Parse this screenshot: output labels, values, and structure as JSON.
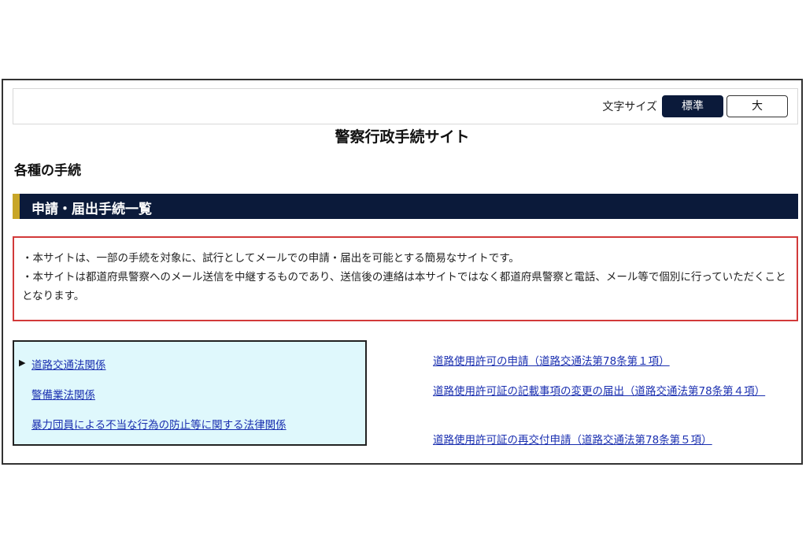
{
  "header": {
    "font_size_label": "文字サイズ",
    "font_size_standard": "標準",
    "font_size_large": "大"
  },
  "site_title": "警察行政手続サイト",
  "section_heading": "各種の手続",
  "banner_title": "申請・届出手続一覧",
  "notice": {
    "line1": "・本サイトは、一部の手続を対象に、試行としてメールでの申請・届出を可能とする簡易なサイトです。",
    "line2": "・本サイトは都道府県警察へのメール送信を中継するものであり、送信後の連絡は本サイトではなく都道府県警察と電話、メール等で個別に行っていただくこととなります。"
  },
  "categories": {
    "selected_marker": "▶",
    "items": [
      "道路交通法関係",
      "警備業法関係",
      "暴力団員による不当な行為の防止等に関する法律関係"
    ]
  },
  "procedures": [
    "道路使用許可の申請（道路交通法第78条第１項）",
    "道路使用許可証の記載事項の変更の届出（道路交通法第78条第４項）",
    "道路使用許可証の再交付申請（道路交通法第78条第５項）"
  ],
  "colors": {
    "navy": "#0b1a3a",
    "gold_accent": "#c8a628",
    "notice_border": "#d23a3a",
    "link_blue": "#1a2fb0",
    "category_bg": "#dff8fc"
  }
}
